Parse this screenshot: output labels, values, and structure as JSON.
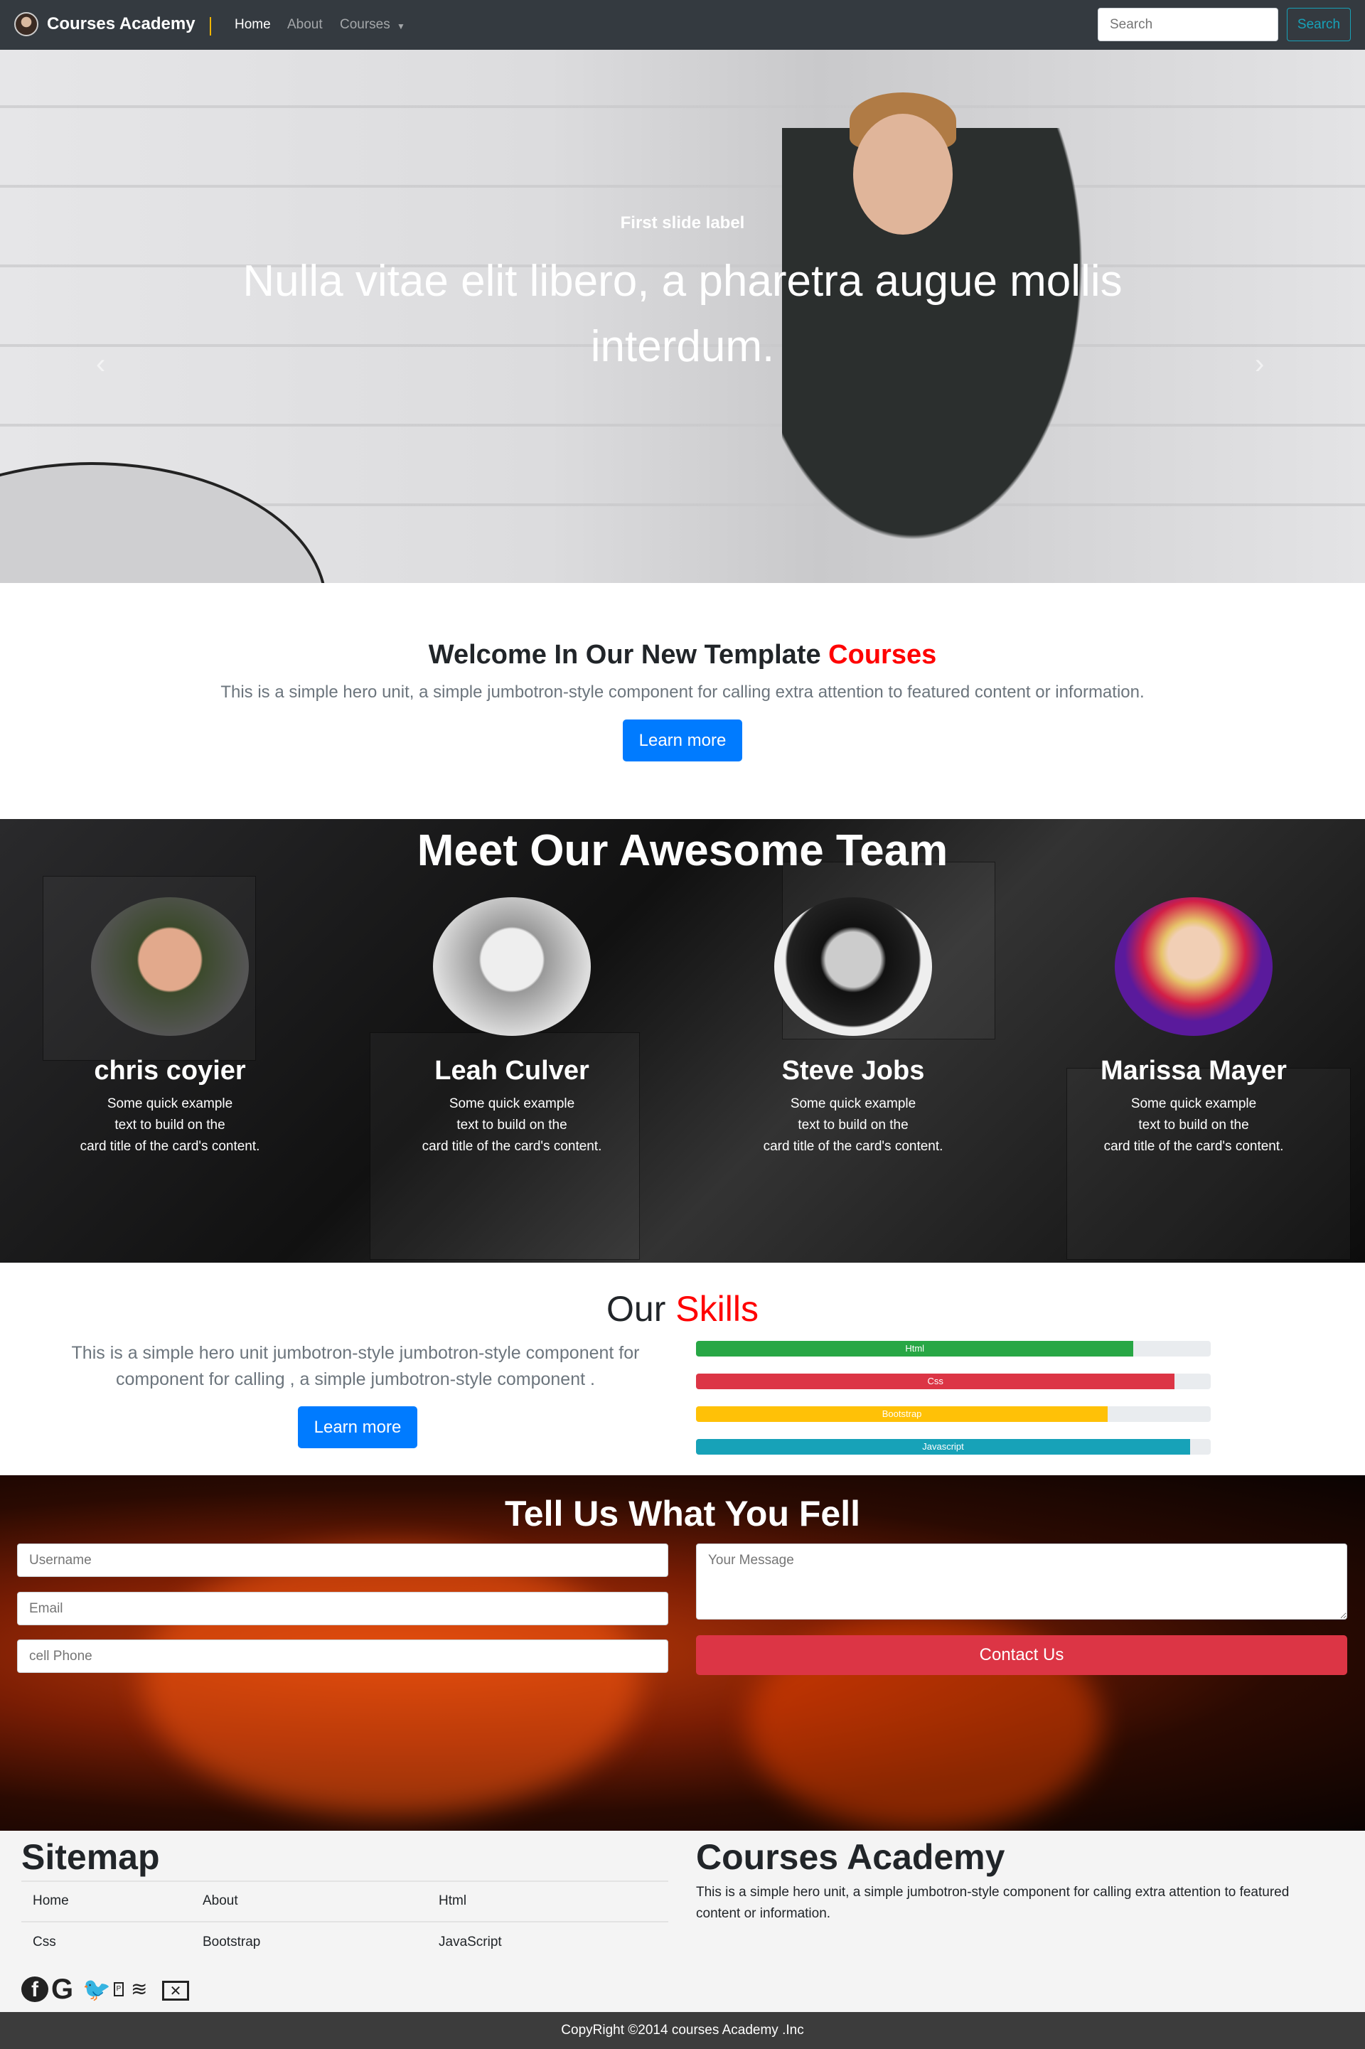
{
  "nav": {
    "brand": "Courses Academy",
    "links": [
      "Home",
      "About",
      "Courses"
    ],
    "search_placeholder": "Search",
    "search_button": "Search"
  },
  "hero": {
    "label": "First slide label",
    "text": "Nulla vitae elit libero, a pharetra augue mollis interdum.",
    "prev": "‹",
    "next": "›",
    "slide_count": 3,
    "active_slide": 1
  },
  "welcome": {
    "title": "Welcome In Our New Template ",
    "title_accent": "Courses",
    "text": "This is a simple hero unit, a simple jumbotron-style component for calling extra attention to featured content or information.",
    "button": "Learn more"
  },
  "team": {
    "title": "Meet Our Awesome Team",
    "members": [
      {
        "name": "chris coyier",
        "desc1": "Some quick example",
        "desc2": "text to build on the",
        "desc3": "card title of the card's content."
      },
      {
        "name": "Leah Culver",
        "desc1": "Some quick example",
        "desc2": "text to build on the",
        "desc3": "card title of the card's content."
      },
      {
        "name": "Steve Jobs",
        "desc1": "Some quick example",
        "desc2": "text to build on the",
        "desc3": "card title of the card's content."
      },
      {
        "name": "Marissa Mayer",
        "desc1": "Some quick example",
        "desc2": "text to build on the",
        "desc3": "card title of the card's content."
      }
    ]
  },
  "skills": {
    "title": "Our ",
    "title_accent": "Skills",
    "text1": "This is a simple hero unit jumbotron-style jumbotron-style component for",
    "text2": "component for calling , a simple jumbotron-style component .",
    "button": "Learn more",
    "bars": [
      {
        "label": "Html",
        "percent": 85,
        "color": "#28a745"
      },
      {
        "label": "Css",
        "percent": 93,
        "color": "#dc3545"
      },
      {
        "label": "Bootstrap",
        "percent": 80,
        "color": "#ffc107"
      },
      {
        "label": "Javascript",
        "percent": 96,
        "color": "#17a2b8"
      }
    ]
  },
  "contact": {
    "title": "Tell Us What You Fell",
    "username": "Username",
    "email": "Email",
    "phone": "cell Phone",
    "message": "Your Message",
    "button": "Contact Us"
  },
  "footer": {
    "sitemap_title": "Sitemap",
    "links": [
      "Home",
      "About",
      "Html",
      "Css",
      "Bootstrap",
      "JavaScript"
    ],
    "about_title": "Courses Academy",
    "about_text": "This is a simple hero unit, a simple jumbotron-style component for calling extra attention to featured content or information.",
    "copyright": "CopyRight ©2014 courses Academy .Inc"
  },
  "colors": {
    "accent": "#ff0000",
    "primary": "#007bff",
    "danger": "#dc3545",
    "navbar": "#343a40"
  }
}
